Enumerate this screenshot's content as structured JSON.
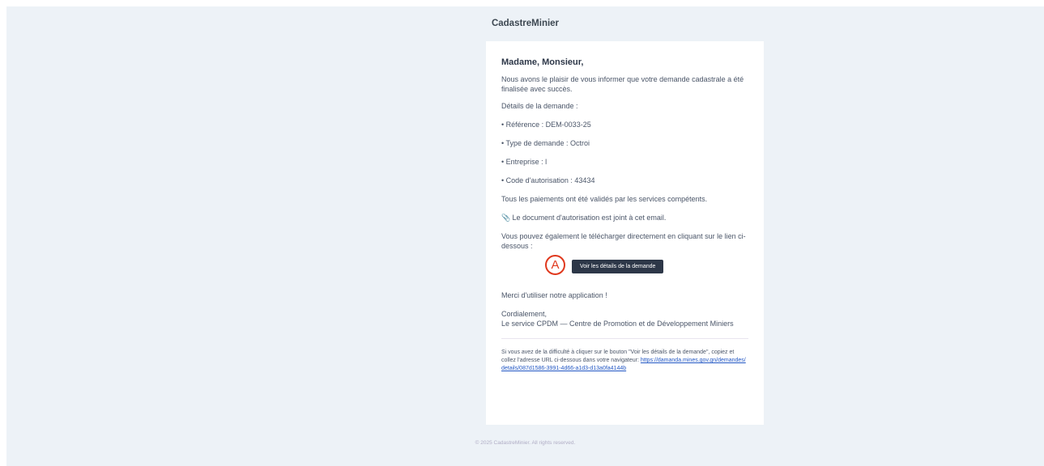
{
  "header": {
    "brand": "CadastreMinier"
  },
  "email": {
    "greeting": "Madame, Monsieur,",
    "intro": "Nous avons le plaisir de vous informer que votre demande cadastrale a été finalisée avec succès.",
    "details_heading": "Détails de la demande :",
    "details": {
      "reference": "• Référence : DEM-0033-25",
      "type": "• Type de demande : Octroi",
      "company": "• Entreprise : l",
      "auth_code": "• Code d'autorisation : 43434"
    },
    "payments": "Tous les paiements ont été validés par les services compétents.",
    "attachment_icon": "paperclip-icon",
    "attachment_glyph": "📎",
    "attachment": "Le document d'autorisation est joint à cet email.",
    "download_hint": "Vous pouvez également le télécharger directement en cliquant sur le lien ci-dessous :",
    "marker_label": "A",
    "button_label": "Voir les détails de la demande",
    "thanks": "Merci d'utiliser notre application !",
    "closing": "Cordialement,",
    "signature": "Le service CPDM — Centre de Promotion et de Développement Miniers",
    "subcopy_text": "Si vous avez de la difficulté à cliquer sur le bouton \"Voir les détails de la demande\", copiez et collez l'adresse URL ci-dessous dans votre navigateur: ",
    "subcopy_link": "https://damanda.mines.gov.gn/demandes/details/087d1586-3991-4d66-a1d3-d13a0fa4144b"
  },
  "footer": {
    "copyright": "© 2025 CadastreMinier. All rights reserved."
  },
  "colors": {
    "background": "#edf2f7",
    "button": "#2d3748",
    "marker": "#e0391e",
    "link": "#2257c4"
  }
}
